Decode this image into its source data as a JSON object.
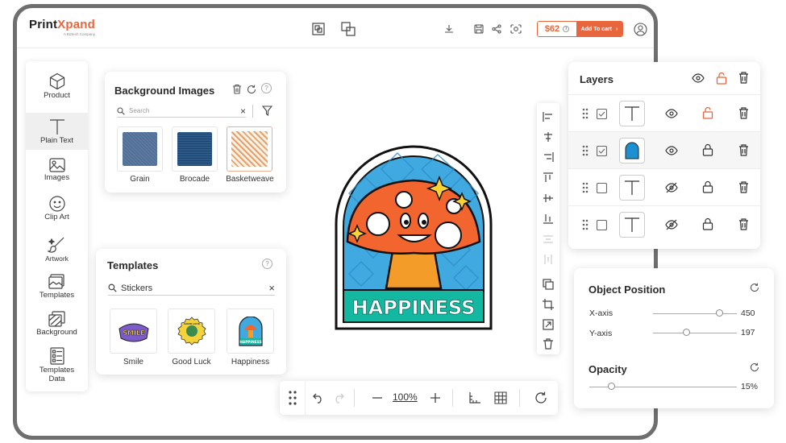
{
  "brand": {
    "name_part1": "Print",
    "name_part2": "Xpand",
    "tagline": "A Biztech Company"
  },
  "header": {
    "price": "$62",
    "add_to_cart": "Add To cart",
    "icons": [
      "layers-front-icon",
      "layers-back-icon",
      "download-icon",
      "save-icon",
      "share-icon",
      "preview-icon",
      "user-icon"
    ]
  },
  "sidebar": {
    "items": [
      {
        "label": "Product",
        "icon": "cube-icon"
      },
      {
        "label": "Plain Text",
        "icon": "text-icon"
      },
      {
        "label": "Images",
        "icon": "image-icon"
      },
      {
        "label": "Clip Art",
        "icon": "smiley-icon"
      },
      {
        "label": "Artwork",
        "icon": "brush-icon"
      },
      {
        "label": "Templates",
        "icon": "templates-icon"
      },
      {
        "label": "Background",
        "icon": "background-icon"
      },
      {
        "label": "Templates",
        "label2": "Data",
        "icon": "templates-data-icon"
      }
    ]
  },
  "background_panel": {
    "title": "Background Images",
    "search_placeholder": "Search",
    "items": [
      {
        "label": "Grain"
      },
      {
        "label": "Brocade"
      },
      {
        "label": "Basketweave"
      }
    ]
  },
  "templates_panel": {
    "title": "Templates",
    "search_value": "Stickers",
    "items": [
      {
        "label": "Smile",
        "art": "SMILE"
      },
      {
        "label": "Good Luck",
        "art": "GOOD LUCK"
      },
      {
        "label": "Happiness",
        "art": "HAPPINESS"
      }
    ]
  },
  "canvas": {
    "sticker_text": "HAPPINESS",
    "zoom": "100%"
  },
  "layers_panel": {
    "title": "Layers",
    "rows": [
      {
        "checked": true,
        "thumb": "text",
        "visible": true,
        "locked": false,
        "selected": false
      },
      {
        "checked": true,
        "thumb": "image",
        "visible": true,
        "locked": true,
        "selected": true
      },
      {
        "checked": false,
        "thumb": "text",
        "visible": false,
        "locked": true,
        "selected": false
      },
      {
        "checked": false,
        "thumb": "text",
        "visible": false,
        "locked": true,
        "selected": false
      }
    ]
  },
  "object_position": {
    "title": "Object Position",
    "x_label": "X-axis",
    "x_value": "450",
    "y_label": "Y-axis",
    "y_value": "197",
    "opacity_title": "Opacity",
    "opacity_value": "15%"
  },
  "colors": {
    "accent": "#e8663d",
    "frame": "#6f6f6f",
    "sticker_blue": "#3fa9e0",
    "sticker_teal": "#14b8a0",
    "mushroom_orange": "#f2652e"
  }
}
